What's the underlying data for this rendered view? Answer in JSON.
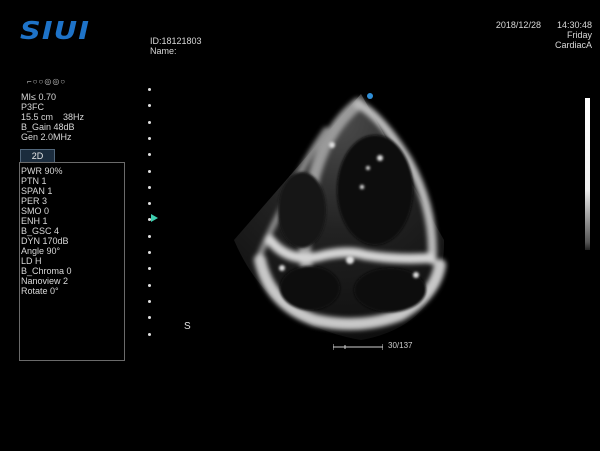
{
  "brand": {
    "logo": "SIUI"
  },
  "patient": {
    "id": "ID:18121803",
    "name": "Name:"
  },
  "datetime": {
    "date": "2018/12/28",
    "time": "14:30:48",
    "weekday": "Friday",
    "preset": "CardiacA"
  },
  "probe_icons": "⌐○○◎◎○",
  "params": [
    "MI≤ 0.70",
    "P3FC",
    "15.5 cm    38Hz",
    "B_Gain 48dB",
    "Gen 2.0MHz"
  ],
  "mode": {
    "tab": "2D"
  },
  "image_params": [
    "PWR 90%",
    "PTN 1",
    "SPAN 1",
    "PER 3",
    "SMO 0",
    "ENH 1",
    "B_GSC 4",
    "DYN 170dB",
    "Angle 90°",
    "LD H",
    "B_Chroma 0",
    "Nanoview 2",
    "Rotate 0°"
  ],
  "orientation": {
    "label": "S"
  },
  "scale": {
    "label": "30/137"
  },
  "colors": {
    "logo": "#1e73c8",
    "focus_marker": "#3ecfb0",
    "orientation_dot": "#2f8fd8",
    "tab_bg": "#1b2c3d"
  }
}
